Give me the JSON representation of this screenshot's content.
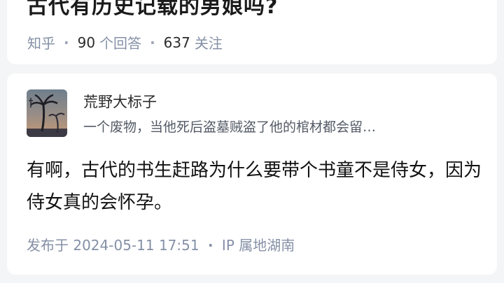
{
  "question": {
    "title": "古代有历史记载的男娘吗?",
    "source": "知乎",
    "answer_count": "90",
    "answer_unit": "个回答",
    "follow_count": "637",
    "follow_unit": "关注"
  },
  "answer": {
    "author": {
      "name": "荒野大标子",
      "bio": "一个废物，当他死后盗墓贼盗了他的棺材都会留…",
      "avatar_icon": "palm-tree-avatar"
    },
    "text": "有啊，古代的书生赶路为什么要带个书童不是侍女，因为侍女真的会怀孕。",
    "published": "发布于 2024-05-11 17:51",
    "ip_location": "IP 属地湖南"
  }
}
